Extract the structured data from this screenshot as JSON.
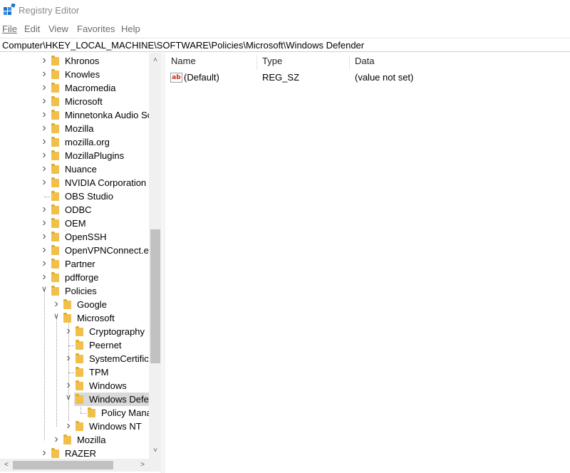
{
  "window": {
    "title": "Registry Editor",
    "app_icon": "registry-editor-icon"
  },
  "menu": [
    {
      "label": "File"
    },
    {
      "label": "Edit"
    },
    {
      "label": "View"
    },
    {
      "label": "Favorites"
    },
    {
      "label": "Help"
    }
  ],
  "address": "Computer\\HKEY_LOCAL_MACHINE\\SOFTWARE\\Policies\\Microsoft\\Windows Defender",
  "tree": [
    {
      "label": "Khronos",
      "depth": 0,
      "expander": "collapsed"
    },
    {
      "label": "Knowles",
      "depth": 0,
      "expander": "collapsed"
    },
    {
      "label": "Macromedia",
      "depth": 0,
      "expander": "collapsed"
    },
    {
      "label": "Microsoft",
      "depth": 0,
      "expander": "collapsed"
    },
    {
      "label": "Minnetonka Audio Sc",
      "depth": 0,
      "expander": "collapsed"
    },
    {
      "label": "Mozilla",
      "depth": 0,
      "expander": "collapsed"
    },
    {
      "label": "mozilla.org",
      "depth": 0,
      "expander": "collapsed"
    },
    {
      "label": "MozillaPlugins",
      "depth": 0,
      "expander": "collapsed"
    },
    {
      "label": "Nuance",
      "depth": 0,
      "expander": "collapsed"
    },
    {
      "label": "NVIDIA Corporation",
      "depth": 0,
      "expander": "collapsed"
    },
    {
      "label": "OBS Studio",
      "depth": 0,
      "expander": "none"
    },
    {
      "label": "ODBC",
      "depth": 0,
      "expander": "collapsed"
    },
    {
      "label": "OEM",
      "depth": 0,
      "expander": "collapsed"
    },
    {
      "label": "OpenSSH",
      "depth": 0,
      "expander": "collapsed"
    },
    {
      "label": "OpenVPNConnect.ex",
      "depth": 0,
      "expander": "collapsed"
    },
    {
      "label": "Partner",
      "depth": 0,
      "expander": "collapsed"
    },
    {
      "label": "pdfforge",
      "depth": 0,
      "expander": "collapsed"
    },
    {
      "label": "Policies",
      "depth": 0,
      "expander": "expanded"
    },
    {
      "label": "Google",
      "depth": 1,
      "expander": "collapsed"
    },
    {
      "label": "Microsoft",
      "depth": 1,
      "expander": "expanded"
    },
    {
      "label": "Cryptography",
      "depth": 2,
      "expander": "collapsed"
    },
    {
      "label": "Peernet",
      "depth": 2,
      "expander": "none"
    },
    {
      "label": "SystemCertifica",
      "depth": 2,
      "expander": "collapsed"
    },
    {
      "label": "TPM",
      "depth": 2,
      "expander": "none"
    },
    {
      "label": "Windows",
      "depth": 2,
      "expander": "collapsed"
    },
    {
      "label": "Windows Defe",
      "depth": 2,
      "expander": "expanded",
      "selected": true
    },
    {
      "label": "Policy Mana",
      "depth": 3,
      "expander": "none"
    },
    {
      "label": "Windows NT",
      "depth": 2,
      "expander": "collapsed"
    },
    {
      "label": "Mozilla",
      "depth": 1,
      "expander": "collapsed"
    },
    {
      "label": "RAZER",
      "depth": 0,
      "expander": "collapsed"
    }
  ],
  "columns": {
    "name": "Name",
    "type": "Type",
    "data": "Data"
  },
  "values": [
    {
      "name": "(Default)",
      "type": "REG_SZ",
      "data": "(value not set)",
      "icon": "string-value-icon",
      "icon_text": "ab"
    }
  ],
  "colors": {
    "selection": "#d9d9d9",
    "folder": "#f0c04a",
    "title_text": "#8a8a8a"
  }
}
